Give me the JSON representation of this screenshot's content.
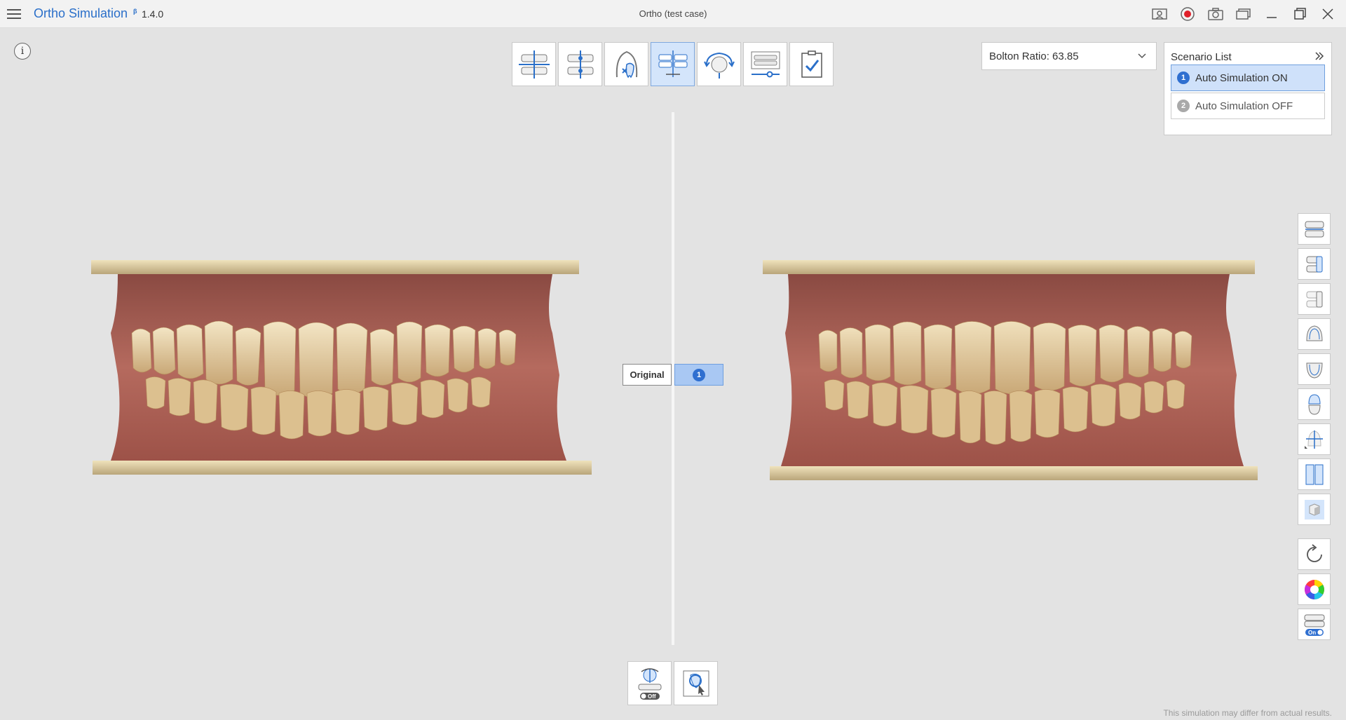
{
  "titlebar": {
    "app_name": "Ortho Simulation",
    "badge": "β",
    "version": "1.4.0",
    "window_title": "Ortho (test case)",
    "icons": [
      "capture-screen-icon",
      "record-icon",
      "camera-icon",
      "window-layout-icon",
      "minimize-icon",
      "maximize-icon",
      "close-icon"
    ],
    "record_color": "#e0202a"
  },
  "info": {
    "label": "i"
  },
  "toolbar": {
    "tools": [
      {
        "name": "occlusion-plane-tool",
        "active": false
      },
      {
        "name": "midline-tool",
        "active": false
      },
      {
        "name": "tooth-exclusion-tool",
        "active": false
      },
      {
        "name": "simulation-compare-tool",
        "active": true
      },
      {
        "name": "rotate-view-tool",
        "active": false
      },
      {
        "name": "stage-slider-tool",
        "active": false
      },
      {
        "name": "confirm-checklist-tool",
        "active": false
      }
    ]
  },
  "bolton": {
    "label": "Bolton Ratio: 63.85"
  },
  "scenarios": {
    "title": "Scenario List",
    "items": [
      {
        "number": "1",
        "label": "Auto Simulation ON",
        "active": true
      },
      {
        "number": "2",
        "label": "Auto Simulation OFF",
        "active": false
      }
    ]
  },
  "viewport": {
    "left_label": "Original",
    "right_label_number": "1"
  },
  "sidebar": {
    "buttons": [
      "front-view-icon",
      "right-view-icon",
      "left-view-icon",
      "upper-jaw-icon",
      "lower-jaw-icon",
      "both-jaws-icon",
      "axis-view-icon",
      "split-view-icon",
      "cube-view-icon",
      "reset-rotation-icon",
      "color-wheel-icon",
      "jaw-toggle-on-icon"
    ],
    "toggle_text": "On"
  },
  "bottom": {
    "buttons": [
      "gravity-off-icon",
      "tooth-select-icon"
    ],
    "gravity_toggle_text": "Off"
  },
  "disclaimer": "This simulation may differ from actual results.",
  "colors": {
    "accent": "#2a6fc9",
    "active_bg": "#cfe1fa",
    "base": "#d9c99a",
    "gum": "#b2665a",
    "tooth": "#e8d3a8"
  }
}
